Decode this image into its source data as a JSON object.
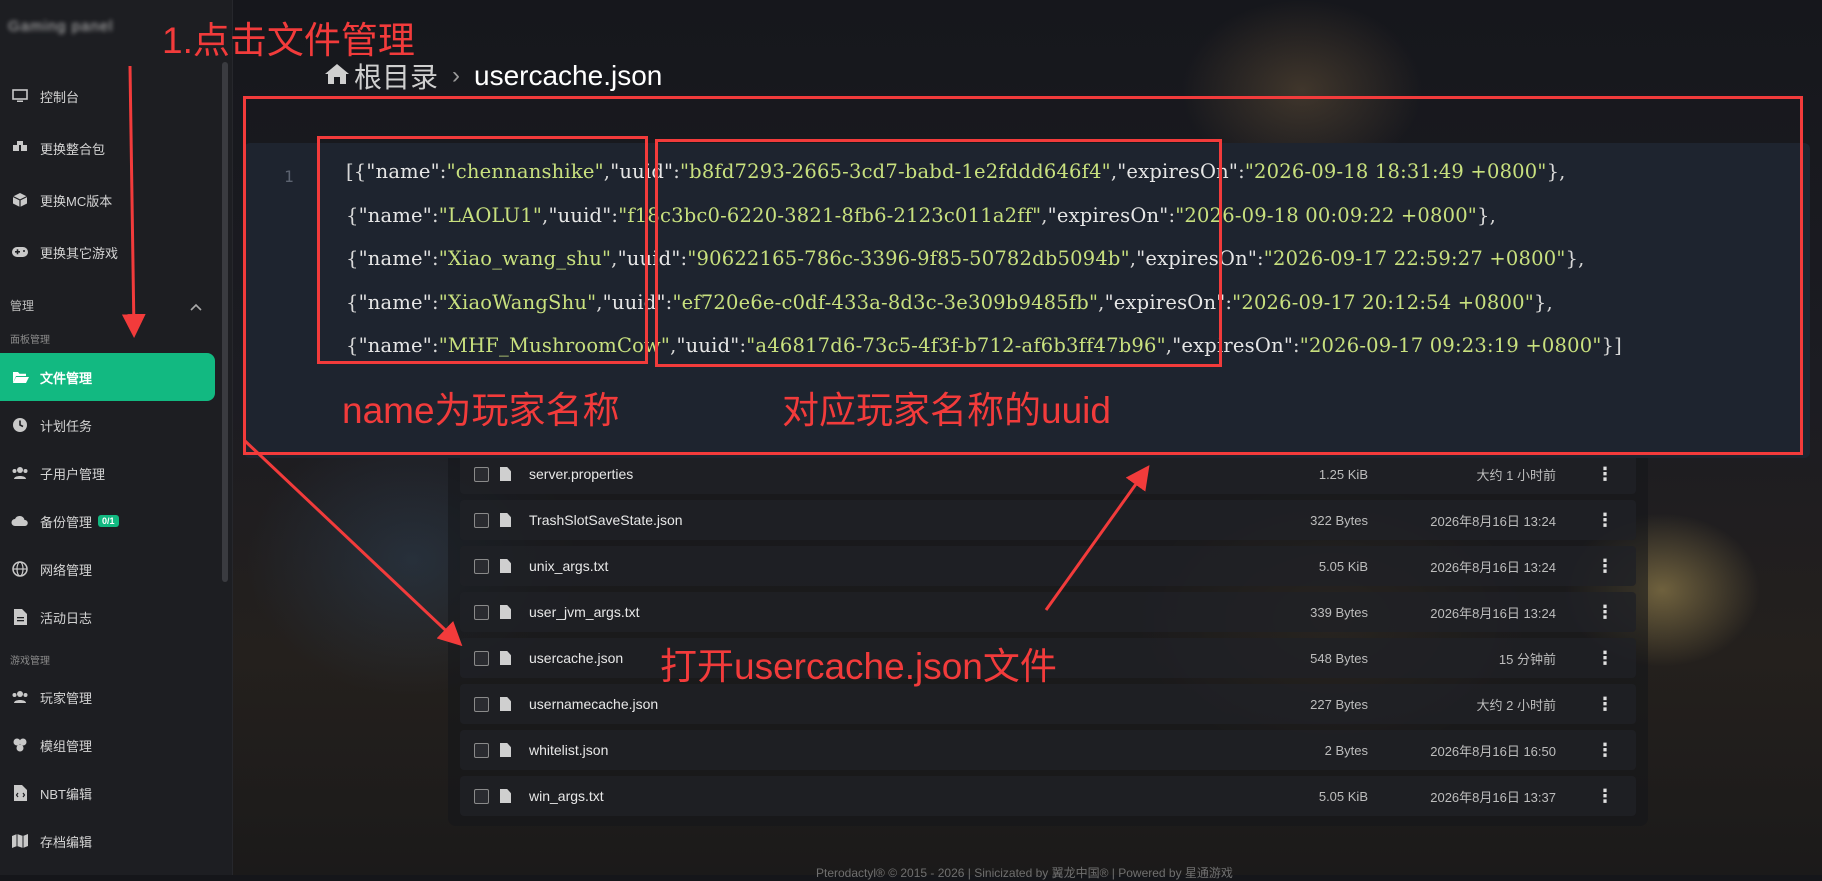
{
  "app": {
    "brand": "Gaming panel"
  },
  "sidebar": {
    "items": [
      {
        "label": "控制台",
        "icon": "monitor-icon"
      },
      {
        "label": "更换整合包",
        "icon": "boxes-icon"
      },
      {
        "label": "更换MC版本",
        "icon": "cube-icon"
      },
      {
        "label": "更换其它游戏",
        "icon": "gamepad-icon"
      }
    ],
    "section_manage": "管理",
    "section_panel": "面板管理",
    "panel_items": [
      {
        "label": "文件管理",
        "icon": "folder-open-icon",
        "active": true
      },
      {
        "label": "计划任务",
        "icon": "clock-icon"
      },
      {
        "label": "子用户管理",
        "icon": "users-icon"
      },
      {
        "label": "备份管理",
        "icon": "cloud-icon",
        "badge": "0/1"
      },
      {
        "label": "网络管理",
        "icon": "globe-icon"
      },
      {
        "label": "活动日志",
        "icon": "file-icon"
      }
    ],
    "section_game": "游戏管理",
    "game_items": [
      {
        "label": "玩家管理",
        "icon": "users-icon"
      },
      {
        "label": "模组管理",
        "icon": "puzzle-icon"
      },
      {
        "label": "NBT编辑",
        "icon": "code-file-icon"
      },
      {
        "label": "存档编辑",
        "icon": "map-icon"
      }
    ]
  },
  "breadcrumb": {
    "root": "根目录",
    "separator": "›",
    "current": "usercache.json"
  },
  "editor": {
    "line_number": "1",
    "lines": [
      "[{\"name\":\"chennanshike\",\"uuid\":\"b8fd7293-2665-3cd7-babd-1e2fddd646f4\",\"expiresOn\":\"2026-09-18 18:31:49 +0800\"},",
      "{\"name\":\"LAOLU1\",\"uuid\":\"f18c3bc0-6220-3821-8fb6-2123c011a2ff\",\"expiresOn\":\"2026-09-18 00:09:22 +0800\"},",
      "{\"name\":\"Xiao_wang_shu\",\"uuid\":\"90622165-786c-3396-9f85-50782db5094b\",\"expiresOn\":\"2026-09-17 22:59:27 +0800\"},",
      "{\"name\":\"XiaoWangShu\",\"uuid\":\"ef720e6e-c0df-433a-8d3c-3e309b9485fb\",\"expiresOn\":\"2026-09-17 20:12:54 +0800\"},",
      "{\"name\":\"MHF_MushroomCow\",\"uuid\":\"a46817d6-73c5-4f3f-b712-af6b3ff47b96\",\"expiresOn\":\"2026-09-17 09:23:19 +0800\"}]"
    ]
  },
  "files": [
    {
      "name": "server.properties",
      "size": "1.25 KiB",
      "time": "大约 1 小时前"
    },
    {
      "name": "TrashSlotSaveState.json",
      "size": "322 Bytes",
      "time": "2026年8月16日 13:24"
    },
    {
      "name": "unix_args.txt",
      "size": "5.05 KiB",
      "time": "2026年8月16日 13:24"
    },
    {
      "name": "user_jvm_args.txt",
      "size": "339 Bytes",
      "time": "2026年8月16日 13:24"
    },
    {
      "name": "usercache.json",
      "size": "548 Bytes",
      "time": "15 分钟前"
    },
    {
      "name": "usernamecache.json",
      "size": "227 Bytes",
      "time": "大约 2 小时前"
    },
    {
      "name": "whitelist.json",
      "size": "2 Bytes",
      "time": "2026年8月16日 16:50"
    },
    {
      "name": "win_args.txt",
      "size": "5.05 KiB",
      "time": "2026年8月16日 13:37"
    }
  ],
  "footer": "Pterodactyl® © 2015 - 2026 | Sinicizated by 翼龙中国® | Powered by 星通游戏",
  "annotations": {
    "step1": "1.点击文件管理",
    "name_note": "name为玩家名称",
    "uuid_note": "对应玩家名称的uuid",
    "open_note": "打开usercache.json文件"
  },
  "colors": {
    "accent": "#12b981",
    "annotation": "#f23b3b",
    "code_string": "#c8e07e"
  }
}
